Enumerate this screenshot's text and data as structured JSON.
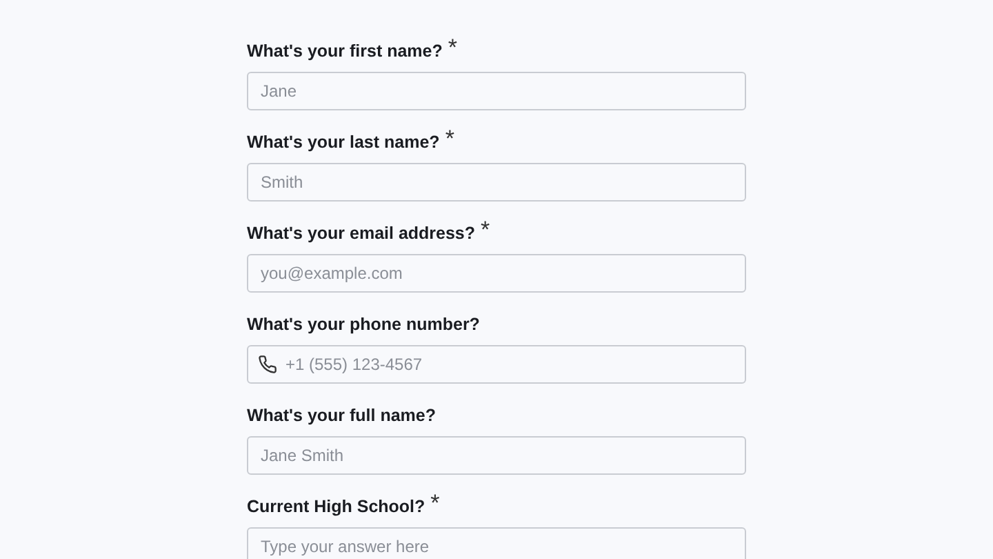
{
  "questions": [
    {
      "label": "What's your first name?",
      "asterisk": "*",
      "placeholder": "Jane",
      "kind": "text"
    },
    {
      "label": "What's your last name?",
      "asterisk": "*",
      "placeholder": "Smith",
      "kind": "text"
    },
    {
      "label": "What's your email address?",
      "asterisk": "*",
      "placeholder": "you@example.com",
      "kind": "text"
    },
    {
      "label": "What's your phone number?",
      "placeholder": "+1 (555) 123-4567",
      "kind": "phone"
    },
    {
      "label": "What's your full name?",
      "placeholder": "Jane Smith",
      "kind": "text"
    },
    {
      "label": "Current High School?",
      "asterisk": "*",
      "placeholder": "Type your answer here",
      "kind": "text"
    }
  ]
}
